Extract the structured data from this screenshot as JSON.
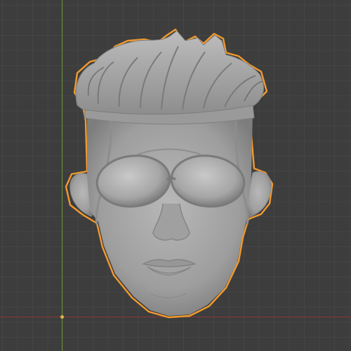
{
  "viewport": {
    "grid_color": "#464646",
    "background_color": "#3d3d3d",
    "y_axis_color": "#6f8f2c",
    "x_axis_color": "#8a3a3a",
    "origin_color": "#d8b44a"
  },
  "model": {
    "selection_outline_color": "#f29a2e",
    "surface_color": "#a7a7a7",
    "state": "selected"
  }
}
